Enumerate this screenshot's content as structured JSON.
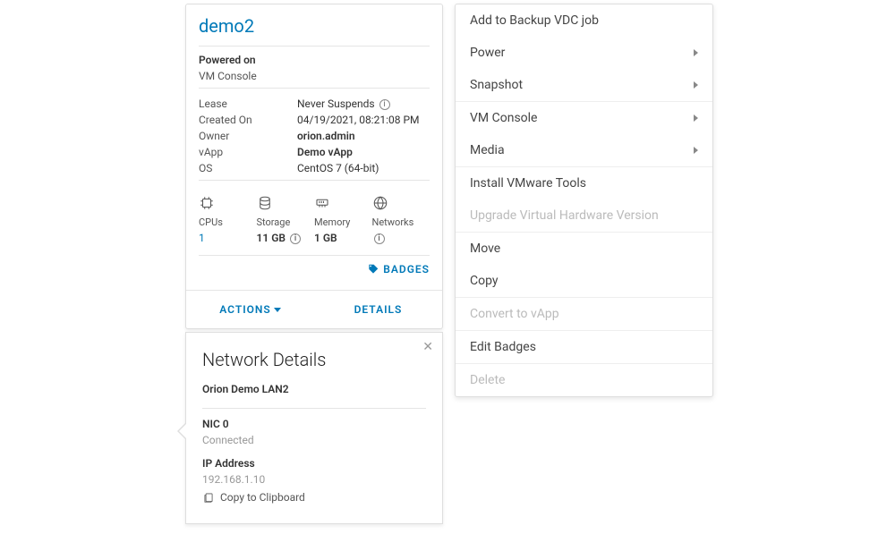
{
  "vm": {
    "title": "demo2",
    "status": "Powered on",
    "console_link": "VM Console",
    "props": {
      "lease_label": "Lease",
      "lease_value": "Never Suspends",
      "created_label": "Created On",
      "created_value": "04/19/2021, 08:21:08 PM",
      "owner_label": "Owner",
      "owner_value": "orion.admin",
      "vapp_label": "vApp",
      "vapp_value": "Demo vApp",
      "os_label": "OS",
      "os_value": "CentOS 7 (64-bit)"
    },
    "resources": {
      "cpus_label": "CPUs",
      "cpus_value": "1",
      "storage_label": "Storage",
      "storage_value": "11 GB",
      "memory_label": "Memory",
      "memory_value": "1 GB",
      "networks_label": "Networks"
    },
    "badges_label": "BADGES",
    "actions_label": "ACTIONS",
    "details_label": "DETAILS"
  },
  "network": {
    "title": "Network Details",
    "name": "Orion Demo LAN2",
    "nic_label": "NIC 0",
    "nic_status": "Connected",
    "ip_label": "IP Address",
    "ip_value": "192.168.1.10",
    "copy_label": "Copy to Clipboard"
  },
  "menu": {
    "backup": "Add to Backup VDC job",
    "power": "Power",
    "snapshot": "Snapshot",
    "vmconsole": "VM Console",
    "media": "Media",
    "installtools": "Install VMware Tools",
    "upgradehw": "Upgrade Virtual Hardware Version",
    "move": "Move",
    "copy": "Copy",
    "convert": "Convert to vApp",
    "editbadges": "Edit Badges",
    "delete": "Delete"
  }
}
